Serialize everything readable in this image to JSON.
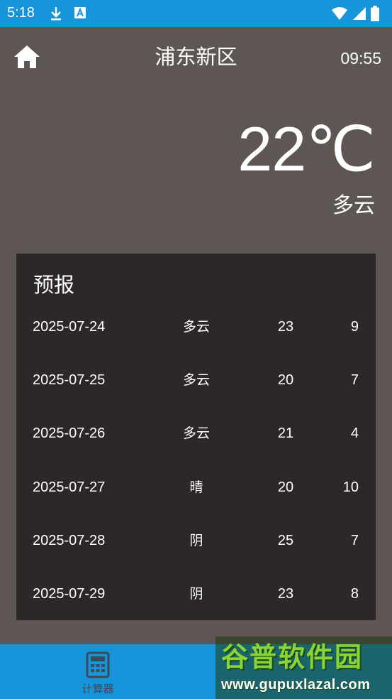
{
  "status_bar": {
    "time": "5:18",
    "icons": [
      "download-icon",
      "notification-a-icon",
      "wifi-icon",
      "signal-icon",
      "battery-icon"
    ]
  },
  "header": {
    "title": "浦东新区",
    "clock": "09:55",
    "home_icon": "home-icon"
  },
  "current": {
    "temperature": "22℃",
    "condition": "多云"
  },
  "forecast": {
    "title": "预报",
    "rows": [
      {
        "date": "2025-07-24",
        "condition": "多云",
        "high": "23",
        "low": "9"
      },
      {
        "date": "2025-07-25",
        "condition": "多云",
        "high": "20",
        "low": "7"
      },
      {
        "date": "2025-07-26",
        "condition": "多云",
        "high": "21",
        "low": "4"
      },
      {
        "date": "2025-07-27",
        "condition": "晴",
        "high": "20",
        "low": "10"
      },
      {
        "date": "2025-07-28",
        "condition": "阴",
        "high": "25",
        "low": "7"
      },
      {
        "date": "2025-07-29",
        "condition": "阴",
        "high": "23",
        "low": "8"
      }
    ]
  },
  "bottom_nav": {
    "items": [
      {
        "label": "计算器",
        "icon": "calculator-icon"
      }
    ]
  },
  "watermark": {
    "title": "谷普软件园",
    "url": "www.gupuxlazal.com"
  },
  "colors": {
    "status_bar": "#1795db",
    "background": "#5e5652",
    "panel": "#2c2828",
    "text": "#ffffff"
  }
}
